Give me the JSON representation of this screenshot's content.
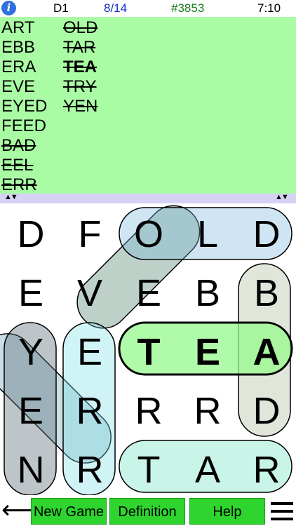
{
  "header": {
    "info_icon_glyph": "i",
    "puzzle_name": "D1",
    "progress": "8/14",
    "game_number": "#3853",
    "timer": "7:10"
  },
  "wordlist": {
    "column1": [
      {
        "text": "ART",
        "found": false,
        "bold": false
      },
      {
        "text": "EBB",
        "found": false,
        "bold": false
      },
      {
        "text": "ERA",
        "found": false,
        "bold": false
      },
      {
        "text": "EVE",
        "found": false,
        "bold": false
      },
      {
        "text": "EYED",
        "found": false,
        "bold": false
      },
      {
        "text": "FEED",
        "found": false,
        "bold": false
      },
      {
        "text": "BAD",
        "found": true,
        "bold": false
      },
      {
        "text": "EEL",
        "found": true,
        "bold": false
      },
      {
        "text": "ERR",
        "found": true,
        "bold": false
      }
    ],
    "column2": [
      {
        "text": "OLD",
        "found": true,
        "bold": false
      },
      {
        "text": "TAR",
        "found": true,
        "bold": false
      },
      {
        "text": "TEA",
        "found": true,
        "bold": true
      },
      {
        "text": "TRY",
        "found": true,
        "bold": false
      },
      {
        "text": "YEN",
        "found": true,
        "bold": false
      }
    ],
    "scroll_arrows": "▲▼"
  },
  "grid": {
    "rows": [
      [
        "D",
        "F",
        "O",
        "L",
        "D"
      ],
      [
        "E",
        "V",
        "E",
        "B",
        "B"
      ],
      [
        "Y",
        "E",
        "T",
        "E",
        "A"
      ],
      [
        "E",
        "R",
        "R",
        "R",
        "D"
      ],
      [
        "N",
        "R",
        "T",
        "A",
        "R"
      ]
    ],
    "bold_row": 2,
    "bold_cols": [
      2,
      3,
      4
    ]
  },
  "bottom_bar": {
    "back_arrow": "⟵",
    "new_game_label": "New Game",
    "definition_label": "Definition",
    "help_label": "Help"
  },
  "colors": {
    "wordlist_bg": "#aafca4",
    "button_green": "#2ed52e",
    "progress_blue": "#1030c8",
    "game_number_green": "#1a7a1a"
  }
}
